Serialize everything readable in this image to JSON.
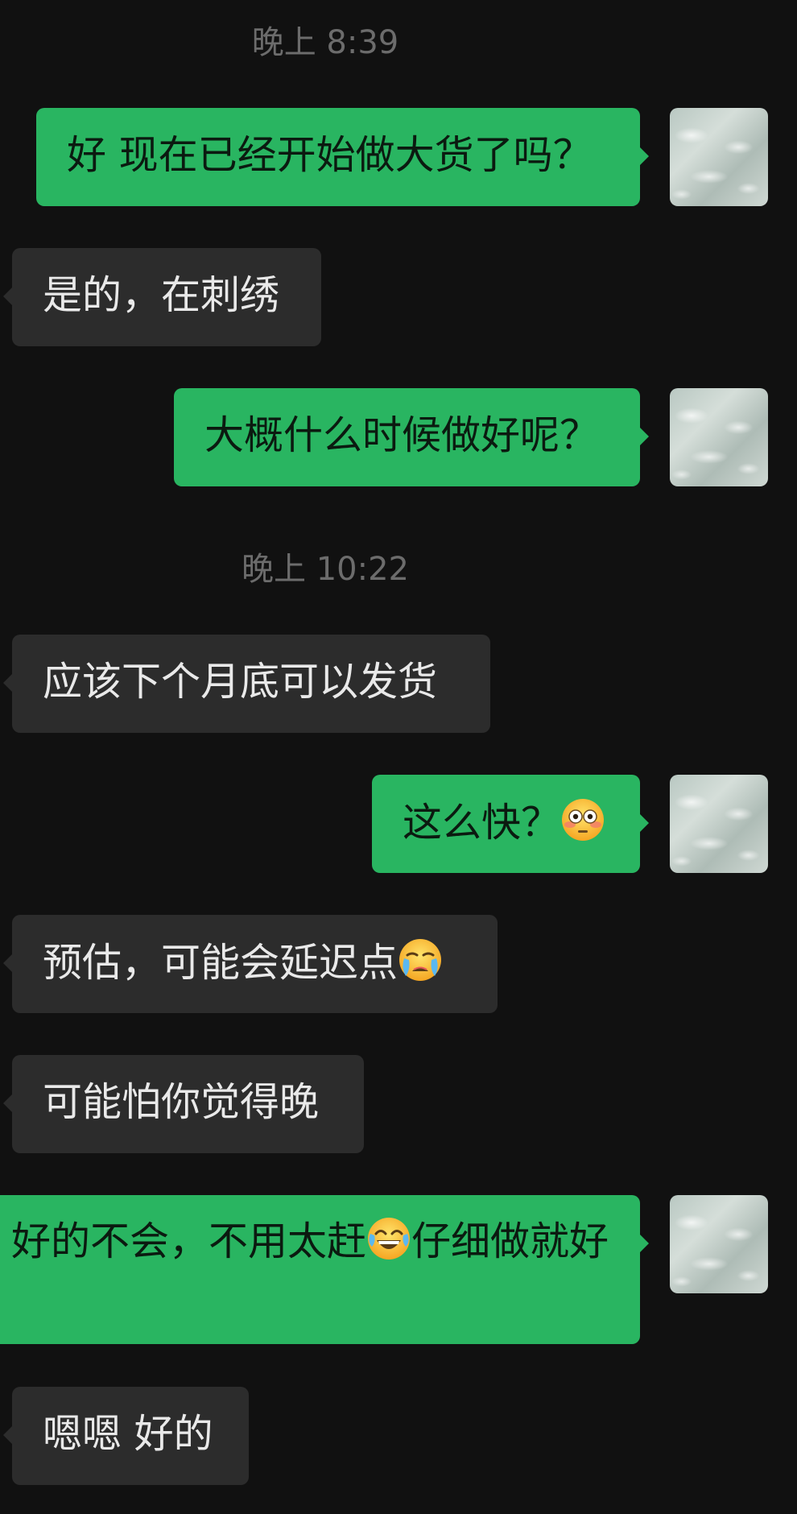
{
  "timestamps": [
    "晚上 8:39",
    "晚上 10:22"
  ],
  "messages": [
    {
      "direction": "out",
      "text": "好 现在已经开始做大货了吗？"
    },
    {
      "direction": "in",
      "text": "是的，在刺绣"
    },
    {
      "direction": "out",
      "text": "大概什么时候做好呢？"
    },
    {
      "direction": "in",
      "text": "应该下个月底可以发货"
    },
    {
      "direction": "out",
      "text": "这么快？",
      "emoji": "flushed-face"
    },
    {
      "direction": "in",
      "text": "预估，可能会延迟点",
      "emoji": "crying-face"
    },
    {
      "direction": "in",
      "text": "可能怕你觉得晚"
    },
    {
      "direction": "out",
      "text_before": "好的不会，不用太赶",
      "emoji": "tears-of-joy-face",
      "text_after": "仔细做就好"
    },
    {
      "direction": "in",
      "text": "嗯嗯 好的"
    }
  ],
  "colors": {
    "background": "#111111",
    "outgoing_bubble": "#29b561",
    "incoming_bubble": "#2c2c2c",
    "timestamp": "#6c6c6c"
  }
}
